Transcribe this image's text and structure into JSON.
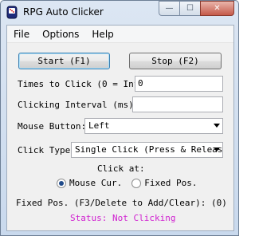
{
  "window": {
    "title": "RPG Auto Clicker",
    "minimize_symbol": "—",
    "maximize_symbol": "☐",
    "close_symbol": "✕"
  },
  "menu": {
    "items": [
      "File",
      "Options",
      "Help"
    ]
  },
  "buttons": {
    "start_label": "Start (F1)",
    "stop_label": "Stop (F2)"
  },
  "form": {
    "times_label": "Times to Click (0 = Infi",
    "times_value": "0",
    "interval_label": "Clicking Interval (ms):",
    "interval_value": "",
    "mouse_button_label": "Mouse Button:",
    "mouse_button_value": "Left",
    "click_type_label": "Click Type:",
    "click_type_value": "Single Click (Press & Releas",
    "click_at_label": "Click at:",
    "click_at_options": [
      "Mouse Cur.",
      "Fixed Pos."
    ],
    "click_at_selected": "Mouse Cur.",
    "fixed_pos_label": "Fixed Pos.  (F3/Delete to Add/Clear): (0)"
  },
  "status": {
    "text": "Status: Not Clicking",
    "color": "#d020d0"
  },
  "icons": {
    "app": "dice-cup-icon"
  }
}
